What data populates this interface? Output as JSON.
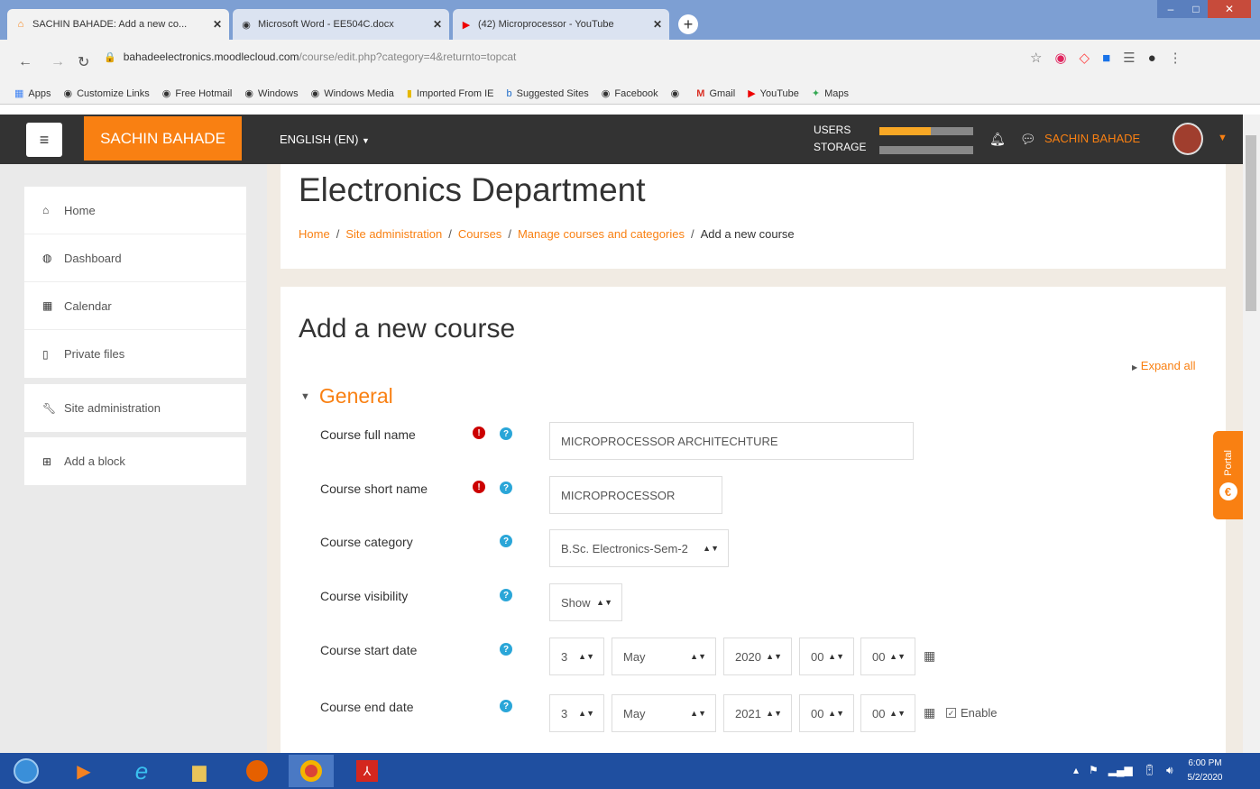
{
  "browser": {
    "tabs": [
      {
        "title": "SACHIN BAHADE: Add a new co...",
        "active": true,
        "icon": "moodle-icon"
      },
      {
        "title": "Microsoft Word - EE504C.docx",
        "active": false,
        "icon": "globe-icon"
      },
      {
        "title": "(42) Microprocessor - YouTube",
        "active": false,
        "icon": "youtube-icon"
      }
    ],
    "address": {
      "domain": "bahadeelectronics.moodlecloud.com",
      "path": "/course/edit.php?category=4&returnto=topcat"
    },
    "bookmarks": [
      {
        "label": "Apps",
        "icon": "apps-grid-icon"
      },
      {
        "label": "Customize Links",
        "icon": "globe-icon"
      },
      {
        "label": "Free Hotmail",
        "icon": "globe-icon"
      },
      {
        "label": "Windows",
        "icon": "globe-icon"
      },
      {
        "label": "Windows Media",
        "icon": "globe-icon"
      },
      {
        "label": "Imported From IE",
        "icon": "folder-icon"
      },
      {
        "label": "Suggested Sites",
        "icon": "bing-icon"
      },
      {
        "label": "Facebook",
        "icon": "globe-icon"
      },
      {
        "label": "",
        "icon": "globe-icon"
      },
      {
        "label": "Gmail",
        "icon": "gmail-icon"
      },
      {
        "label": "YouTube",
        "icon": "youtube-icon"
      },
      {
        "label": "Maps",
        "icon": "maps-icon"
      }
    ]
  },
  "navbar": {
    "site_name": "SACHIN BAHADE",
    "language": "ENGLISH (EN)",
    "quota": {
      "users_label": "USERS",
      "storage_label": "STORAGE",
      "users_fraction": 0.55,
      "storage_fraction": 0.0
    },
    "user_name": "SACHIN BAHADE"
  },
  "drawer": {
    "items": [
      {
        "label": "Home",
        "icon": "home-icon"
      },
      {
        "label": "Dashboard",
        "icon": "dashboard-icon"
      },
      {
        "label": "Calendar",
        "icon": "calendar-icon"
      },
      {
        "label": "Private files",
        "icon": "file-icon"
      }
    ],
    "admin": {
      "label": "Site administration",
      "icon": "wrench-icon"
    },
    "add_block": {
      "label": "Add a block",
      "icon": "plus-square-icon"
    }
  },
  "header": {
    "title": "Electronics Department",
    "breadcrumb": [
      "Home",
      "Site administration",
      "Courses",
      "Manage courses and categories",
      "Add a new course"
    ]
  },
  "form": {
    "title": "Add a new course",
    "expand_all": "Expand all",
    "section": "General",
    "fields": {
      "fullname": {
        "label": "Course full name",
        "value": "MICROPROCESSOR ARCHITECHTURE"
      },
      "shortname": {
        "label": "Course short name",
        "value": "MICROPROCESSOR"
      },
      "category": {
        "label": "Course category",
        "value": "B.Sc. Electronics-Sem-2"
      },
      "visibility": {
        "label": "Course visibility",
        "value": "Show"
      },
      "startdate": {
        "label": "Course start date",
        "day": "3",
        "month": "May",
        "year": "2020",
        "hour": "00",
        "minute": "00"
      },
      "enddate": {
        "label": "Course end date",
        "day": "3",
        "month": "May",
        "year": "2021",
        "hour": "00",
        "minute": "00",
        "enable_label": "Enable"
      }
    }
  },
  "portal_tab": "Portal",
  "taskbar": {
    "time": "6:00 PM",
    "date": "5/2/2020"
  }
}
